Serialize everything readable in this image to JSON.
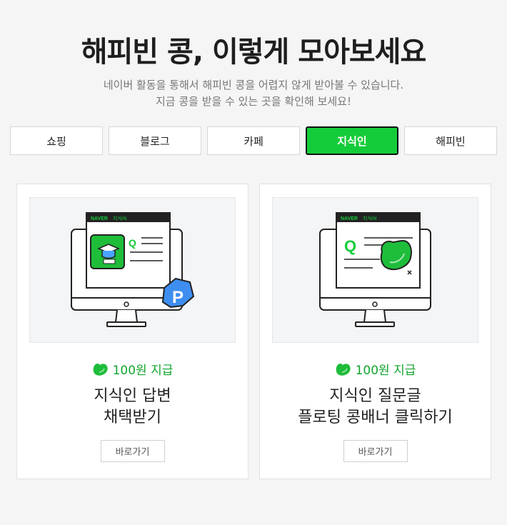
{
  "header": {
    "title": "해피빈 콩, 이렇게 모아보세요",
    "subtitle_line1": "네이버 활동을 통해서 해피빈 콩을 어렵지 않게 받아볼 수 있습니다.",
    "subtitle_line2": "지금 콩을 받을 수 있는 곳을 확인해 보세요!"
  },
  "tabs": [
    {
      "label": "쇼핑",
      "active": false
    },
    {
      "label": "블로그",
      "active": false
    },
    {
      "label": "카페",
      "active": false
    },
    {
      "label": "지식인",
      "active": true
    },
    {
      "label": "해피빈",
      "active": false
    }
  ],
  "cards": [
    {
      "window_brand": "NAVER",
      "window_service": "지식iN",
      "q_mark": "Q",
      "badge_letter": "P",
      "reward": "100원 지급",
      "title_line1": "지식인 답변",
      "title_line2": "채택받기",
      "button": "바로가기"
    },
    {
      "window_brand": "NAVER",
      "window_service": "지식iN",
      "q_mark": "Q",
      "reward": "100원 지급",
      "title_line1": "지식인 질문글",
      "title_line2": "플로팅 콩배너 클릭하기",
      "button": "바로가기"
    }
  ],
  "colors": {
    "accent_green": "#14cc39",
    "reward_green": "#12a42d",
    "badge_blue": "#3d8ef0"
  }
}
